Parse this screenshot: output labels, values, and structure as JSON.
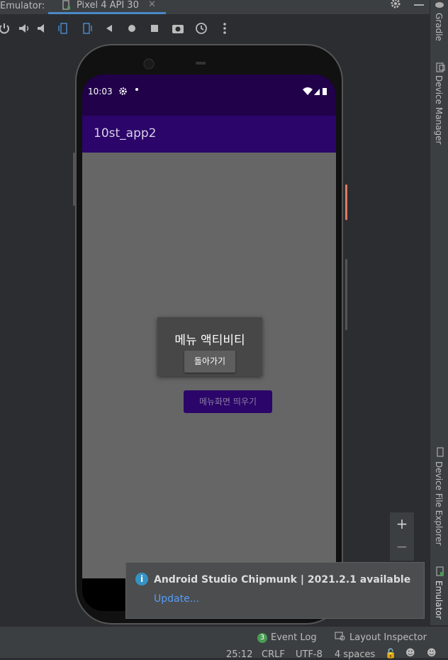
{
  "tabbar": {
    "label": "Emulator:",
    "tab_title": "Pixel 4 API 30",
    "close": "✕"
  },
  "phone": {
    "status_time": "10:03",
    "app_title": "10st_app2",
    "dialog_title": "메뉴 액티비티",
    "dialog_button": "돌아가기",
    "main_button": "메뉴화면 띄우기"
  },
  "right_panel": {
    "gradle": "Gradle",
    "device_manager": "Device Manager",
    "device_file_explorer": "Device File Explorer",
    "emulator": "Emulator"
  },
  "zoom": {
    "plus": "+",
    "minus": "−"
  },
  "notification": {
    "title": "Android Studio Chipmunk | 2021.2.1 available",
    "link": "Update..."
  },
  "bottom": {
    "event_log_count": "3",
    "event_log": "Event Log",
    "layout_inspector": "Layout Inspector"
  },
  "status": {
    "position": "25:12",
    "line_sep": "CRLF",
    "encoding": "UTF-8",
    "indent": "4 spaces"
  },
  "colors": {
    "status_bar": "#21014a",
    "app_bar": "#2b0569",
    "accent_link": "#589df6"
  }
}
